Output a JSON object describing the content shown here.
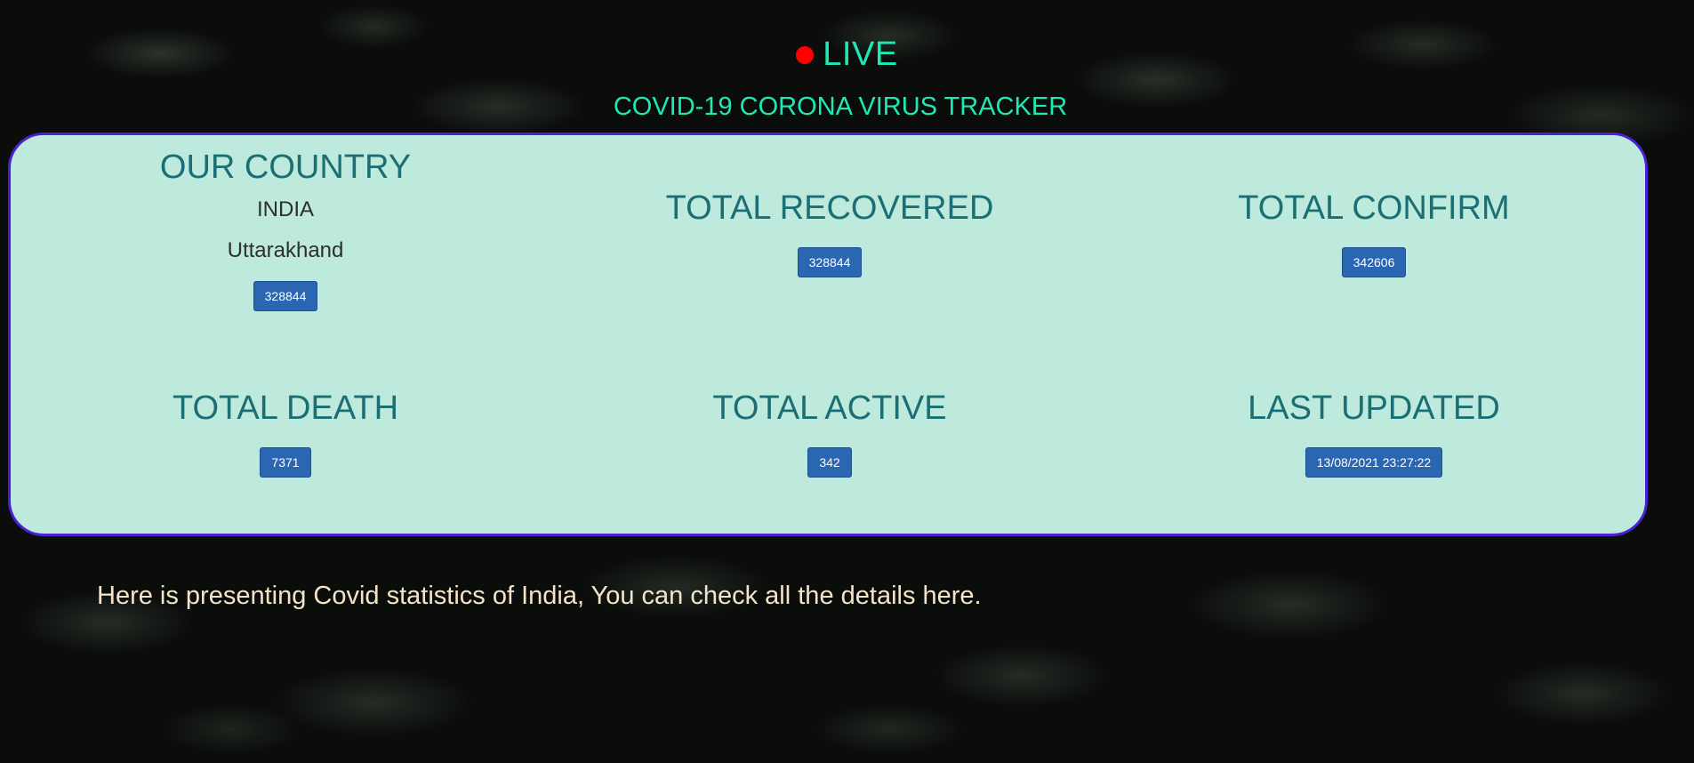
{
  "header": {
    "live_label": "LIVE",
    "title": "COVID-19 CORONA VIRUS TRACKER"
  },
  "country": {
    "heading": "OUR COUNTRY",
    "name": "INDIA",
    "state": "Uttarakhand",
    "value": "328844"
  },
  "recovered": {
    "heading": "TOTAL RECOVERED",
    "value": "328844"
  },
  "confirm": {
    "heading": "TOTAL CONFIRM",
    "value": "342606"
  },
  "death": {
    "heading": "TOTAL DEATH",
    "value": "7371"
  },
  "active": {
    "heading": "TOTAL ACTIVE",
    "value": "342"
  },
  "updated": {
    "heading": "LAST UPDATED",
    "value": "13/08/2021 23:27:22"
  },
  "footer": {
    "text": "Here is presenting Covid statistics of India, You can check all the details here."
  },
  "colors": {
    "accent": "#1de9b6",
    "live_dot": "#ff0000",
    "card_bg": "#bdeadc",
    "card_border": "#4b1fd6",
    "heading": "#1b6f74",
    "button": "#2a66b1"
  }
}
